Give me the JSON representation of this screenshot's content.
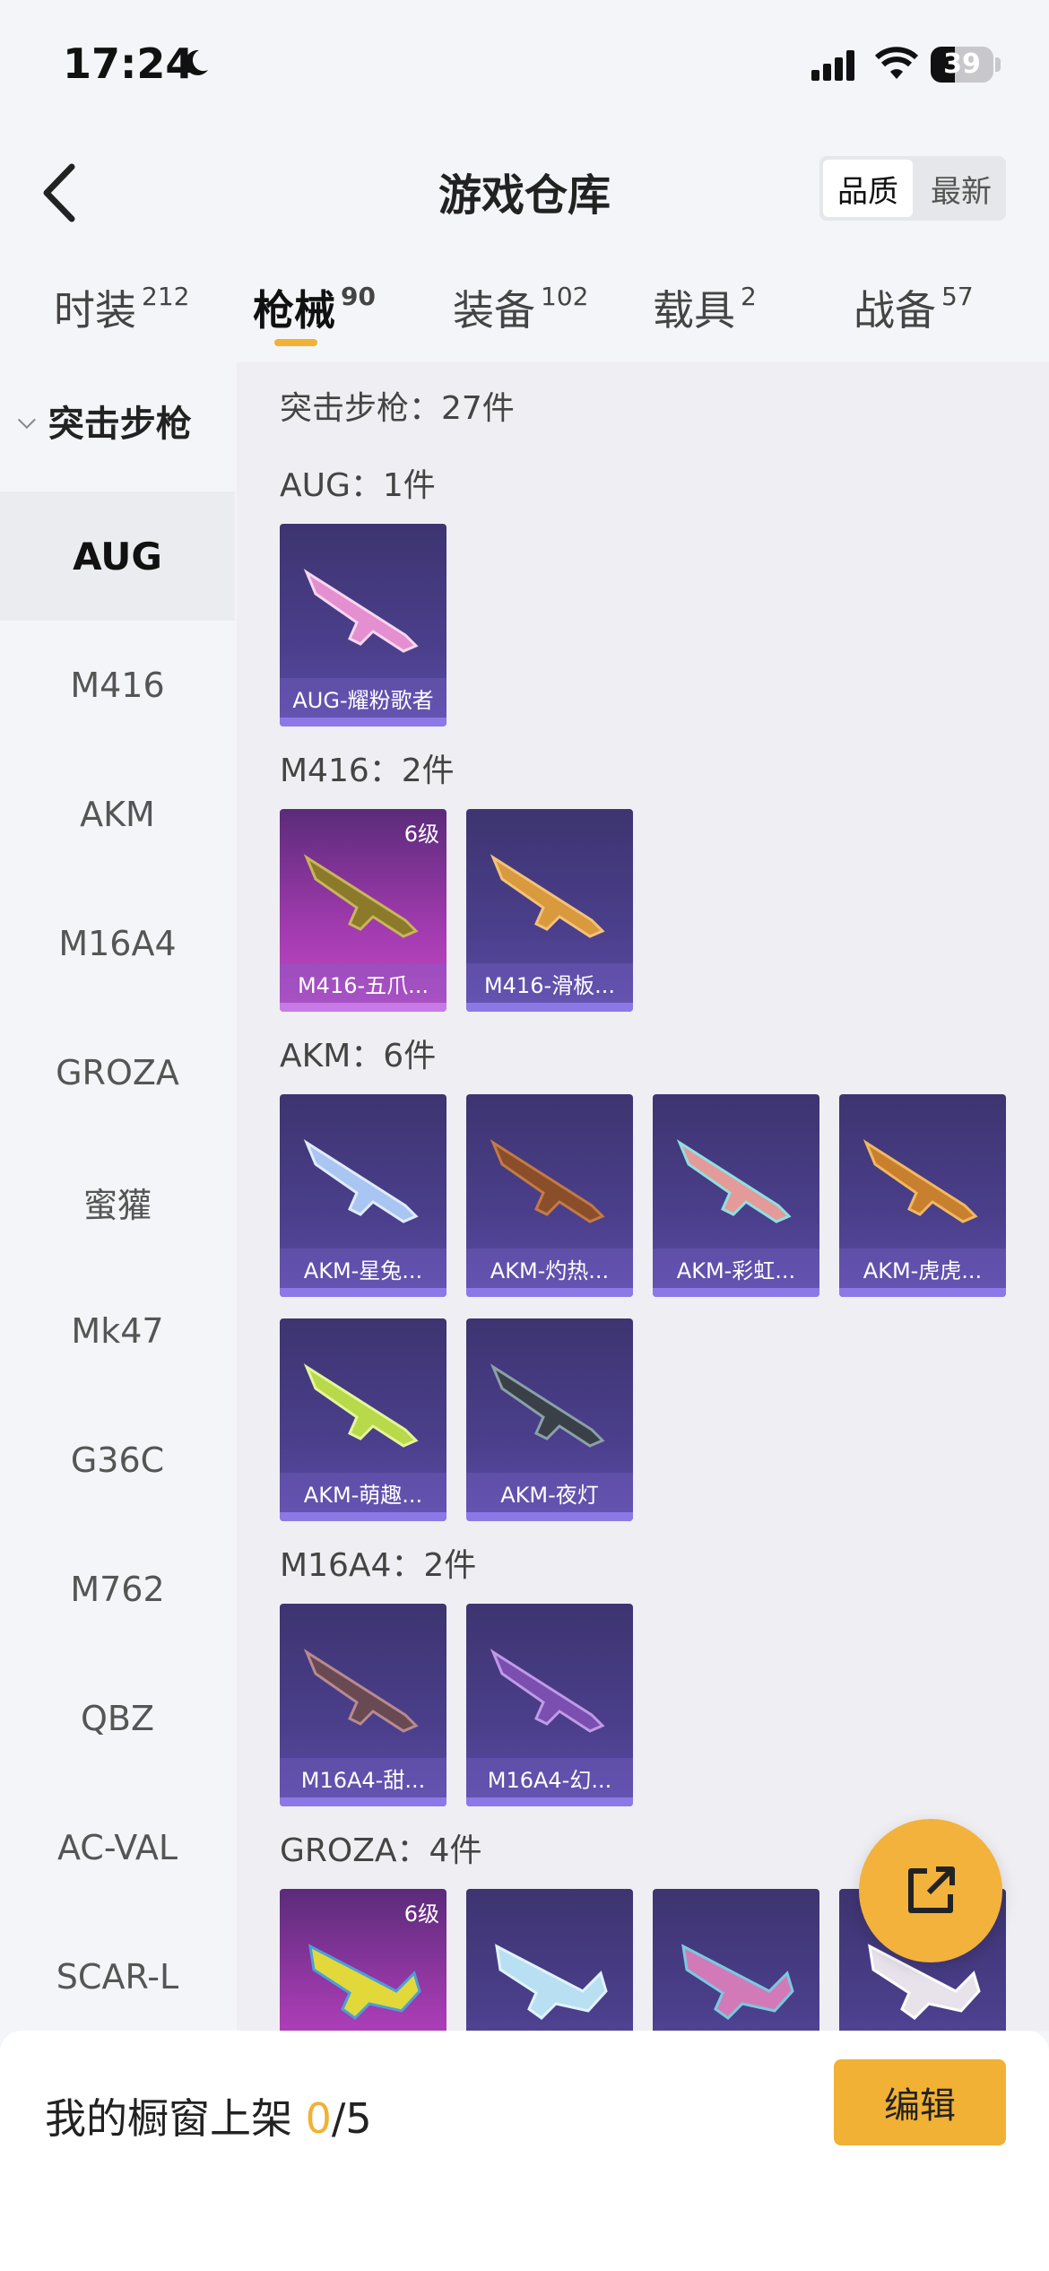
{
  "status_bar": {
    "time": "17:24",
    "battery": "39",
    "battery_level": 0.39
  },
  "header": {
    "title": "游戏仓库",
    "sort_options": [
      "品质",
      "最新"
    ],
    "sort_selected": "品质"
  },
  "tabs": [
    {
      "label": "时装",
      "count": "212"
    },
    {
      "label": "枪械",
      "count": "90"
    },
    {
      "label": "装备",
      "count": "102"
    },
    {
      "label": "载具",
      "count": "2"
    },
    {
      "label": "战备",
      "count": "57"
    }
  ],
  "active_tab": "枪械",
  "sidebar": {
    "header": "突击步枪",
    "items": [
      "AUG",
      "M416",
      "AKM",
      "M16A4",
      "GROZA",
      "蜜獾",
      "Mk47",
      "G36C",
      "M762",
      "QBZ",
      "AC-VAL",
      "SCAR-L"
    ],
    "active": "AUG"
  },
  "content": {
    "total": "突击步枪：27件",
    "groups": [
      {
        "label": "AUG：1件",
        "items": [
          {
            "name": "AUG-耀粉歌者"
          }
        ]
      },
      {
        "label": "M416：2件",
        "items": [
          {
            "name": "M416-五爪...",
            "level": "6级"
          },
          {
            "name": "M416-滑板..."
          }
        ]
      },
      {
        "label": "AKM：6件",
        "items": [
          {
            "name": "AKM-星兔..."
          },
          {
            "name": "AKM-灼热..."
          },
          {
            "name": "AKM-彩虹..."
          },
          {
            "name": "AKM-虎虎..."
          },
          {
            "name": "AKM-萌趣..."
          },
          {
            "name": "AKM-夜灯"
          }
        ]
      },
      {
        "label": "M16A4：2件",
        "items": [
          {
            "name": "M16A4-甜..."
          },
          {
            "name": "M16A4-幻..."
          }
        ]
      },
      {
        "label": "GROZA：4件",
        "items": [
          {
            "name": "",
            "level": "6级"
          },
          {
            "name": ""
          },
          {
            "name": ""
          },
          {
            "name": ""
          }
        ]
      }
    ]
  },
  "footer": {
    "shelf_prefix": "我的橱窗上架 ",
    "shelf_current": "0",
    "shelf_total": "/5",
    "edit_label": "编辑"
  },
  "colors": {
    "accent": "#f0b135",
    "card_purple": "#4b3f8c",
    "card_pink": "#a33bb0"
  }
}
